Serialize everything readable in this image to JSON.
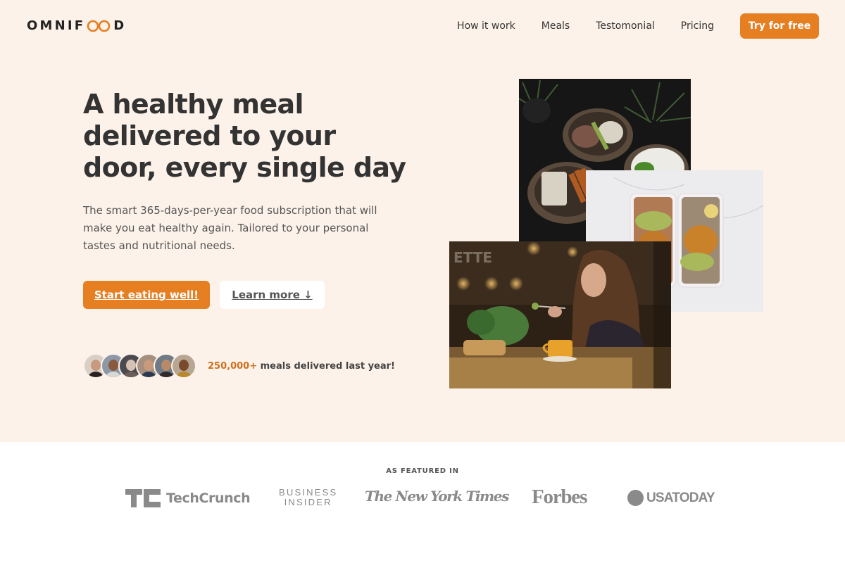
{
  "header": {
    "logo_prefix": "OMNIF",
    "logo_suffix": "D",
    "logo_accent": "#e67e22",
    "nav": [
      {
        "label": "How it work"
      },
      {
        "label": "Meals"
      },
      {
        "label": "Testomonial"
      },
      {
        "label": "Pricing"
      }
    ],
    "cta_label": "Try for free"
  },
  "hero": {
    "headline": "A healthy meal delivered to your door, every single day",
    "description": "The smart 365-days-per-year food subscription that will make you eat healthy again. Tailored to your personal tastes and nutritional needs.",
    "primary_button": "Start eating well!",
    "secondary_button": "Learn more ↓",
    "delivered_count": "250,000+",
    "delivered_text": "meals delivered last year!",
    "customer_avatars": 6,
    "images": [
      {
        "name": "bowls-of-food"
      },
      {
        "name": "meal-prep-boxes"
      },
      {
        "name": "woman-enjoying-meal"
      }
    ]
  },
  "featured": {
    "label": "AS FEATURED IN",
    "logos": [
      {
        "name": "TechCrunch",
        "text": "TechCrunch",
        "mark": "TC"
      },
      {
        "name": "Business Insider",
        "line1": "BUSINESS",
        "line2": "INSIDER"
      },
      {
        "name": "The New York Times",
        "text": "The New York Times"
      },
      {
        "name": "Forbes",
        "text": "Forbes"
      },
      {
        "name": "USA Today",
        "text": "USATODAY"
      }
    ]
  },
  "colors": {
    "primary": "#e67e22",
    "hero_background": "#fdf2e9",
    "text_dark": "#333333",
    "logo_gray": "#8a8a8a"
  }
}
